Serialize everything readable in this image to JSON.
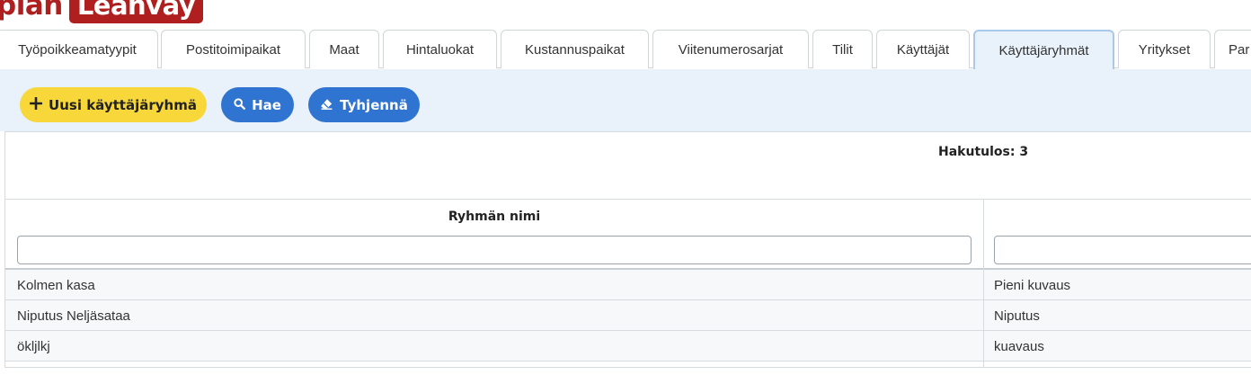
{
  "logo": {
    "left_text": "plan",
    "right_text": "Leanvay"
  },
  "tabs": [
    {
      "label": "Työpoikkeamatyypit",
      "active": false
    },
    {
      "label": "Postitoimipaikat",
      "active": false
    },
    {
      "label": "Maat",
      "active": false
    },
    {
      "label": "Hintaluokat",
      "active": false
    },
    {
      "label": "Kustannuspaikat",
      "active": false
    },
    {
      "label": "Viitenumerosarjat",
      "active": false
    },
    {
      "label": "Tilit",
      "active": false
    },
    {
      "label": "Käyttäjät",
      "active": false
    },
    {
      "label": "Käyttäjäryhmät",
      "active": true
    },
    {
      "label": "Yritykset",
      "active": false
    },
    {
      "label": "Par",
      "active": false
    }
  ],
  "toolbar": {
    "new_label": "Uusi käyttäjäryhmä",
    "search_label": "Hae",
    "clear_label": "Tyhjennä"
  },
  "result": {
    "text": "Hakutulos: 3"
  },
  "table": {
    "columns": [
      "Ryhmän nimi",
      ""
    ],
    "filters": [
      {
        "value": "",
        "placeholder": ""
      },
      {
        "value": "",
        "placeholder": ""
      }
    ],
    "rows": [
      {
        "name": "Kolmen kasa",
        "description": "Pieni kuvaus"
      },
      {
        "name": "Niputus Neljäsataa",
        "description": "Niputus"
      },
      {
        "name": "ökljlkj",
        "description": "kuavaus"
      }
    ]
  },
  "colors": {
    "brand_red": "#b01f1f",
    "primary_blue": "#2f74d0",
    "accent_yellow": "#f7d739",
    "toolbar_bg": "#e9f1fa"
  }
}
